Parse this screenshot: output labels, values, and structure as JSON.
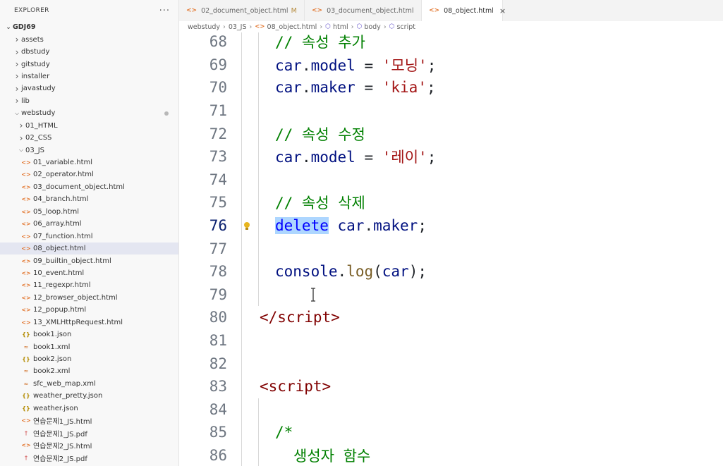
{
  "explorer": {
    "title": "EXPLORER",
    "more": "···",
    "root": "GDJ69",
    "items": [
      {
        "label": "assets",
        "kind": "folder",
        "depth": 1,
        "expanded": false
      },
      {
        "label": "dbstudy",
        "kind": "folder",
        "depth": 1,
        "expanded": false
      },
      {
        "label": "gitstudy",
        "kind": "folder",
        "depth": 1,
        "expanded": false
      },
      {
        "label": "installer",
        "kind": "folder",
        "depth": 1,
        "expanded": false
      },
      {
        "label": "javastudy",
        "kind": "folder",
        "depth": 1,
        "expanded": false
      },
      {
        "label": "lib",
        "kind": "folder",
        "depth": 1,
        "expanded": false
      },
      {
        "label": "webstudy",
        "kind": "folder",
        "depth": 1,
        "expanded": true,
        "modified": true
      },
      {
        "label": "01_HTML",
        "kind": "folder",
        "depth": 2,
        "expanded": false
      },
      {
        "label": "02_CSS",
        "kind": "folder",
        "depth": 2,
        "expanded": false
      },
      {
        "label": "03_JS",
        "kind": "folder",
        "depth": 2,
        "expanded": true
      },
      {
        "label": "01_variable.html",
        "kind": "html",
        "depth": 3
      },
      {
        "label": "02_operator.html",
        "kind": "html",
        "depth": 3
      },
      {
        "label": "03_document_object.html",
        "kind": "html",
        "depth": 3
      },
      {
        "label": "04_branch.html",
        "kind": "html",
        "depth": 3
      },
      {
        "label": "05_loop.html",
        "kind": "html",
        "depth": 3
      },
      {
        "label": "06_array.html",
        "kind": "html",
        "depth": 3
      },
      {
        "label": "07_function.html",
        "kind": "html",
        "depth": 3
      },
      {
        "label": "08_object.html",
        "kind": "html",
        "depth": 3,
        "selected": true
      },
      {
        "label": "09_builtin_object.html",
        "kind": "html",
        "depth": 3
      },
      {
        "label": "10_event.html",
        "kind": "html",
        "depth": 3
      },
      {
        "label": "11_regexpr.html",
        "kind": "html",
        "depth": 3
      },
      {
        "label": "12_browser_object.html",
        "kind": "html",
        "depth": 3
      },
      {
        "label": "12_popup.html",
        "kind": "html",
        "depth": 3
      },
      {
        "label": "13_XMLHttpRequest.html",
        "kind": "html",
        "depth": 3
      },
      {
        "label": "book1.json",
        "kind": "json",
        "depth": 3
      },
      {
        "label": "book1.xml",
        "kind": "xml",
        "depth": 3
      },
      {
        "label": "book2.json",
        "kind": "json",
        "depth": 3
      },
      {
        "label": "book2.xml",
        "kind": "xml",
        "depth": 3
      },
      {
        "label": "sfc_web_map.xml",
        "kind": "xml",
        "depth": 3
      },
      {
        "label": "weather_pretty.json",
        "kind": "json",
        "depth": 3
      },
      {
        "label": "weather.json",
        "kind": "json",
        "depth": 3
      },
      {
        "label": "연습문제1_JS.html",
        "kind": "html",
        "depth": 3
      },
      {
        "label": "연습문제1_JS.pdf",
        "kind": "pdf",
        "depth": 3
      },
      {
        "label": "연습문제2_JS.html",
        "kind": "html",
        "depth": 3
      },
      {
        "label": "연습문제2_JS.pdf",
        "kind": "pdf",
        "depth": 3
      }
    ]
  },
  "tabs": [
    {
      "label": "02_document_object.html",
      "modified": "M",
      "active": false
    },
    {
      "label": "03_document_object.html",
      "active": false
    },
    {
      "label": "08_object.html",
      "active": true,
      "close": "×"
    }
  ],
  "breadcrumb": {
    "parts": [
      "webstudy",
      "03_JS",
      "08_object.html",
      "html",
      "body",
      "script"
    ]
  },
  "editor": {
    "lines": [
      {
        "n": "68",
        "indent": 1,
        "tokens": [
          {
            "t": "// 속성 추가",
            "c": "comment"
          }
        ]
      },
      {
        "n": "69",
        "indent": 1,
        "tokens": [
          {
            "t": "car",
            "c": "ident"
          },
          {
            "t": ".",
            "c": "punc"
          },
          {
            "t": "model",
            "c": "ident"
          },
          {
            "t": " = ",
            "c": "punc"
          },
          {
            "t": "'모닝'",
            "c": "str"
          },
          {
            "t": ";",
            "c": "punc"
          }
        ]
      },
      {
        "n": "70",
        "indent": 1,
        "tokens": [
          {
            "t": "car",
            "c": "ident"
          },
          {
            "t": ".",
            "c": "punc"
          },
          {
            "t": "maker",
            "c": "ident"
          },
          {
            "t": " = ",
            "c": "punc"
          },
          {
            "t": "'kia'",
            "c": "str"
          },
          {
            "t": ";",
            "c": "punc"
          }
        ]
      },
      {
        "n": "71",
        "indent": 1,
        "tokens": []
      },
      {
        "n": "72",
        "indent": 1,
        "tokens": [
          {
            "t": "// 속성 수정",
            "c": "comment"
          }
        ]
      },
      {
        "n": "73",
        "indent": 1,
        "tokens": [
          {
            "t": "car",
            "c": "ident"
          },
          {
            "t": ".",
            "c": "punc"
          },
          {
            "t": "model",
            "c": "ident"
          },
          {
            "t": " = ",
            "c": "punc"
          },
          {
            "t": "'레이'",
            "c": "str"
          },
          {
            "t": ";",
            "c": "punc"
          }
        ]
      },
      {
        "n": "74",
        "indent": 1,
        "tokens": []
      },
      {
        "n": "75",
        "indent": 1,
        "tokens": [
          {
            "t": "// 속성 삭제",
            "c": "comment"
          }
        ]
      },
      {
        "n": "76",
        "indent": 1,
        "active": true,
        "tokens": [
          {
            "t": "delete",
            "c": "kw",
            "hl": true
          },
          {
            "t": " ",
            "c": "punc"
          },
          {
            "t": "car",
            "c": "ident"
          },
          {
            "t": ".",
            "c": "punc"
          },
          {
            "t": "maker",
            "c": "ident"
          },
          {
            "t": ";",
            "c": "punc"
          }
        ]
      },
      {
        "n": "77",
        "indent": 1,
        "tokens": []
      },
      {
        "n": "78",
        "indent": 1,
        "tokens": [
          {
            "t": "console",
            "c": "ident"
          },
          {
            "t": ".",
            "c": "punc"
          },
          {
            "t": "log",
            "c": "fn"
          },
          {
            "t": "(",
            "c": "punc"
          },
          {
            "t": "car",
            "c": "ident"
          },
          {
            "t": ");",
            "c": "punc"
          }
        ]
      },
      {
        "n": "79",
        "indent": 1,
        "tokens": []
      },
      {
        "n": "80",
        "indent": 0,
        "tokens": [
          {
            "t": "</",
            "c": "tag"
          },
          {
            "t": "script",
            "c": "tag"
          },
          {
            "t": ">",
            "c": "tag"
          }
        ]
      },
      {
        "n": "81",
        "indent": 0,
        "tokens": []
      },
      {
        "n": "82",
        "indent": 0,
        "tokens": []
      },
      {
        "n": "83",
        "indent": 0,
        "tokens": [
          {
            "t": "<",
            "c": "tag"
          },
          {
            "t": "script",
            "c": "tag"
          },
          {
            "t": ">",
            "c": "tag"
          }
        ]
      },
      {
        "n": "84",
        "indent": 1,
        "tokens": []
      },
      {
        "n": "85",
        "indent": 1,
        "tokens": [
          {
            "t": "/*",
            "c": "comment"
          }
        ]
      },
      {
        "n": "86",
        "indent": 2,
        "tokens": [
          {
            "t": "생성자 함수",
            "c": "comment"
          }
        ]
      }
    ]
  },
  "colors": {
    "comment": "#008000",
    "ident": "#001080",
    "string": "#a31515",
    "keyword": "#0000ff",
    "tag": "#800000",
    "function": "#795e26",
    "selection": "#add6ff",
    "lightbulb": "#e8b620"
  },
  "icons": {
    "bulb": "lightbulb-icon",
    "cursor": "text-cursor-icon"
  }
}
